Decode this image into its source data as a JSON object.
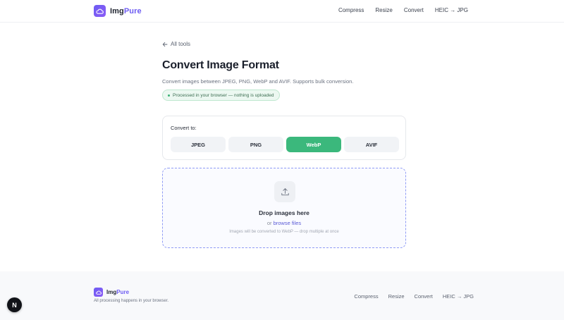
{
  "header": {
    "brand_main": "Img",
    "brand_accent": "Pure",
    "nav": [
      "Compress",
      "Resize",
      "Convert",
      "HEIC → JPG"
    ]
  },
  "main": {
    "back_label": "All tools",
    "title": "Convert Image Format",
    "subtitle": "Convert images between JPEG, PNG, WebP and AVIF. Supports bulk conversion.",
    "badge": "Processed in your browser — nothing is uploaded",
    "convert_label": "Convert to:",
    "formats": [
      "JPEG",
      "PNG",
      "WebP",
      "AVIF"
    ],
    "selected_format": "WebP",
    "dropzone": {
      "title": "Drop images here",
      "browse_prefix": "or",
      "browse_link": "browse files",
      "note": "Images will be converted to WebP — drop multiple at once"
    }
  },
  "footer": {
    "brand_main": "Img",
    "brand_accent": "Pure",
    "tagline": "All processing happens in your browser.",
    "nav": [
      "Compress",
      "Resize",
      "Convert",
      "HEIC → JPG"
    ]
  },
  "dev_badge": "N",
  "colors": {
    "accent": "#6d5cf2",
    "selected": "#3bb87c",
    "badge_bg": "#ecf8f1",
    "dropzone_border": "#8f9bf5"
  },
  "icons": [
    "cloud-logo-icon",
    "arrow-left-icon",
    "upload-icon",
    "dot-icon"
  ]
}
